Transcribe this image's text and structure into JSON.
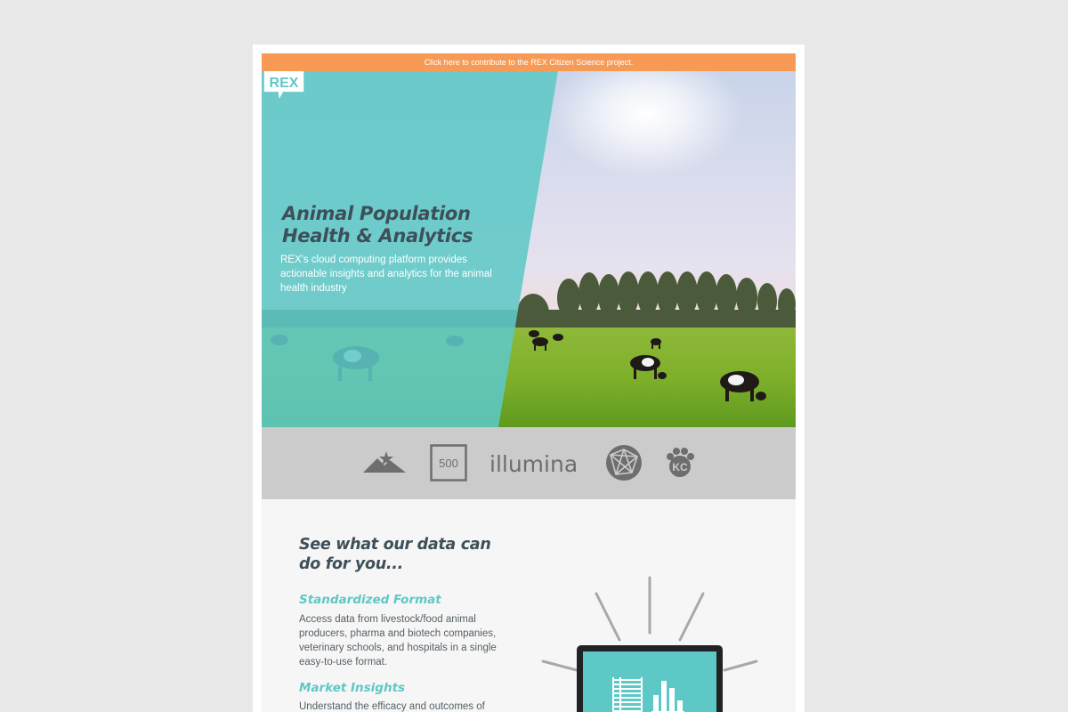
{
  "banner": {
    "text": "Click here to contribute to the REX Citizen Science project."
  },
  "brand": {
    "logo_text": "REX"
  },
  "hero": {
    "title_line1": "Animal Population",
    "title_line2": "Health & Analytics",
    "subtitle": "REX's cloud computing platform provides actionable insights and analytics for the animal health industry"
  },
  "partners": [
    {
      "icon": "mountain-star-logo"
    },
    {
      "icon": "500-logo",
      "text": "500"
    },
    {
      "icon": "illumina-logo",
      "text": "illumina"
    },
    {
      "icon": "globe-network-logo"
    },
    {
      "icon": "paw-kc-logo",
      "text": "KC"
    }
  ],
  "content": {
    "heading_line1": "See what our data can",
    "heading_line2": "do for you...",
    "features": [
      {
        "title": "Standardized Format",
        "body": "Access data from livestock/food animal producers, pharma and biotech companies, veterinary schools, and hospitals in a single easy-to-use format."
      },
      {
        "title": "Market Insights",
        "body": "Understand the efficacy and outcomes of"
      }
    ]
  },
  "colors": {
    "accent_teal": "#5ec8c6",
    "banner_orange": "#f79a55",
    "heading_dark": "#3d4f59",
    "logo_strip_gray": "#cbcbcb"
  }
}
